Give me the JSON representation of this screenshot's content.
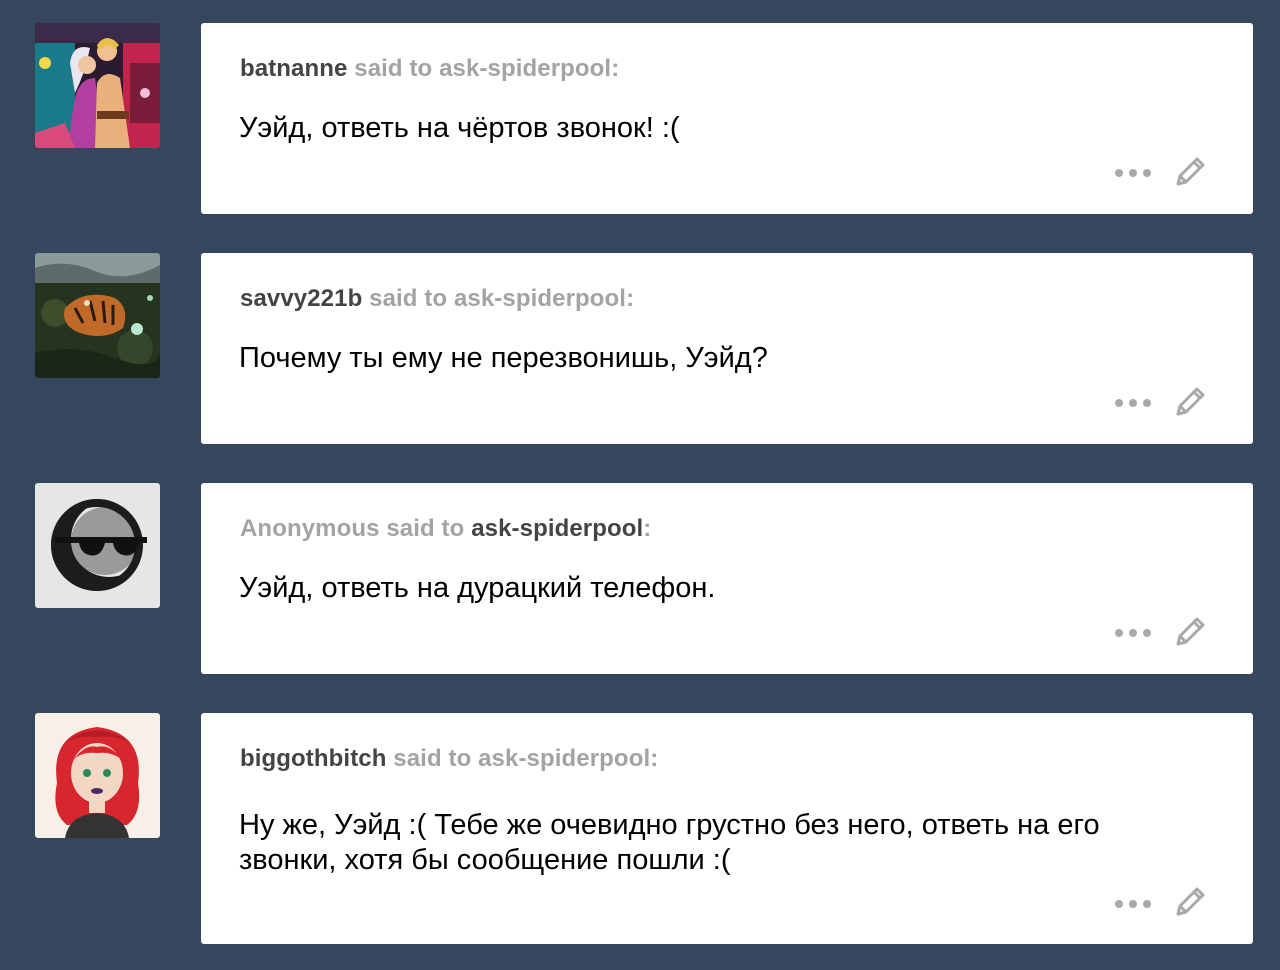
{
  "colors": {
    "background": "#36465d",
    "card": "#ffffff",
    "username": "#444444",
    "meta": "#a3a3a3",
    "icon": "#a9a9a9"
  },
  "said_to": "said to",
  "blog": "ask-spiderpool",
  "colon": ":",
  "posts": [
    {
      "asker": "batnanne",
      "question": "Уэйд, ответь на чёртов звонок! :(",
      "avatar_icon": "comic-couple-avatar"
    },
    {
      "asker": "savvy221b",
      "question": "Почему ты ему не перезвонишь, Уэйд?",
      "avatar_icon": "tiger-in-water-avatar"
    },
    {
      "asker": "Anonymous",
      "question": "Уэйд, ответь на дурацкий телефон.",
      "avatar_icon": "anonymous-sunglasses-avatar"
    },
    {
      "asker": "biggothbitch",
      "question": "Ну же, Уэйд :( Тебе же очевидно грустно без него, ответь на его звонки, хотя бы сообщение пошли :(",
      "avatar_icon": "red-hair-girl-drawing-avatar"
    }
  ],
  "icons": {
    "more": "more-dots-icon",
    "edit": "pencil-edit-icon"
  }
}
